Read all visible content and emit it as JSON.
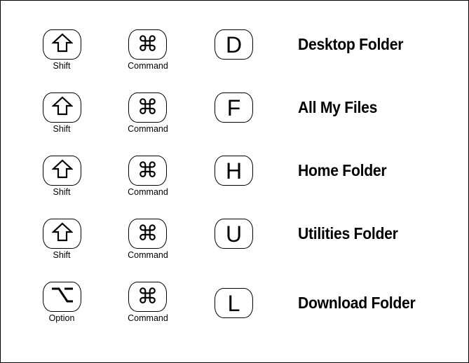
{
  "shortcuts": [
    {
      "modifier": {
        "icon": "shift-icon",
        "glyph": "⇧",
        "label": "Shift"
      },
      "command": {
        "icon": "command-icon",
        "glyph": "⌘",
        "label": "Command"
      },
      "key": "D",
      "action": "Desktop Folder"
    },
    {
      "modifier": {
        "icon": "shift-icon",
        "glyph": "⇧",
        "label": "Shift"
      },
      "command": {
        "icon": "command-icon",
        "glyph": "⌘",
        "label": "Command"
      },
      "key": "F",
      "action": "All My Files"
    },
    {
      "modifier": {
        "icon": "shift-icon",
        "glyph": "⇧",
        "label": "Shift"
      },
      "command": {
        "icon": "command-icon",
        "glyph": "⌘",
        "label": "Command"
      },
      "key": "H",
      "action": "Home Folder"
    },
    {
      "modifier": {
        "icon": "shift-icon",
        "glyph": "⇧",
        "label": "Shift"
      },
      "command": {
        "icon": "command-icon",
        "glyph": "⌘",
        "label": "Command"
      },
      "key": "U",
      "action": "Utilities Folder"
    },
    {
      "modifier": {
        "icon": "option-icon",
        "glyph": "⌥",
        "label": "Option"
      },
      "command": {
        "icon": "command-icon",
        "glyph": "⌘",
        "label": "Command"
      },
      "key": "L",
      "action": "Download Folder"
    }
  ]
}
